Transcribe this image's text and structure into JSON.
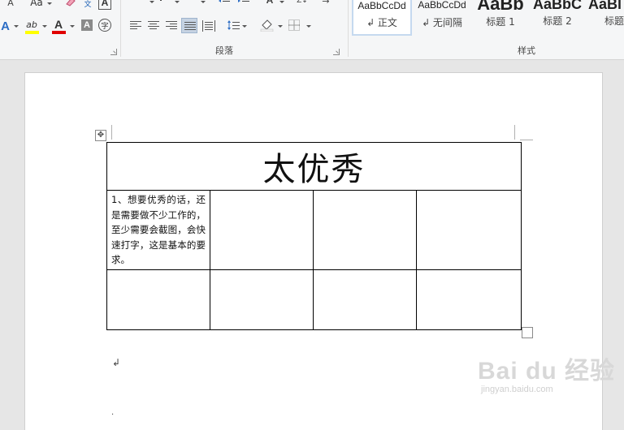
{
  "ribbon": {
    "font_group": {
      "icons": [
        "font-color-a-small-icon",
        "change-case-icon",
        "eraser-icon",
        "phonetic-guide-icon",
        "char-border-icon",
        "text-effects-icon",
        "highlight-icon",
        "font-color-icon",
        "char-shading-icon",
        "enclose-char-icon"
      ],
      "change_case_label": "Aa",
      "a_small": "A",
      "text_effect_glyph": "A",
      "highlight_glyph": "ab",
      "font_color_glyph": "A",
      "shading_glyph": "A",
      "enclose_glyph": "字",
      "phonetic_glyph": "文",
      "border_glyph": "A",
      "highlight_color": "#ffff00",
      "font_color": "#e00000"
    },
    "paragraph_group": {
      "label": "段落",
      "sort_label": "Z↓"
    },
    "styles_group": {
      "label": "样式",
      "items": [
        {
          "preview": "AaBbCcDd",
          "name": "↲ 正文",
          "selected": true
        },
        {
          "preview": "AaBbCcDd",
          "name": "↲ 无间隔",
          "selected": false
        },
        {
          "preview": "AaBb",
          "name": "标题 1",
          "selected": false
        },
        {
          "preview": "AaBbC",
          "name": "标题 2",
          "selected": false
        },
        {
          "preview": "AaBl",
          "name": "标题",
          "selected": false
        }
      ]
    }
  },
  "document": {
    "table": {
      "title": "太优秀",
      "cell_text": "1、想要优秀的话，还是需要做不少工作的，至少需要会截图，会快速打字，这是基本的要求。",
      "columns": 4,
      "rows_after_title": 2
    },
    "paragraph_mark": "↲",
    "second_mark": "·"
  },
  "watermark": {
    "main": "Bai du 经验",
    "sub": "jingyan.baidu.com"
  },
  "colors": {
    "ribbon_bg": "#f5f6f7",
    "canvas_bg": "#e6e6e6",
    "selected_align": "#c6d3e3"
  }
}
